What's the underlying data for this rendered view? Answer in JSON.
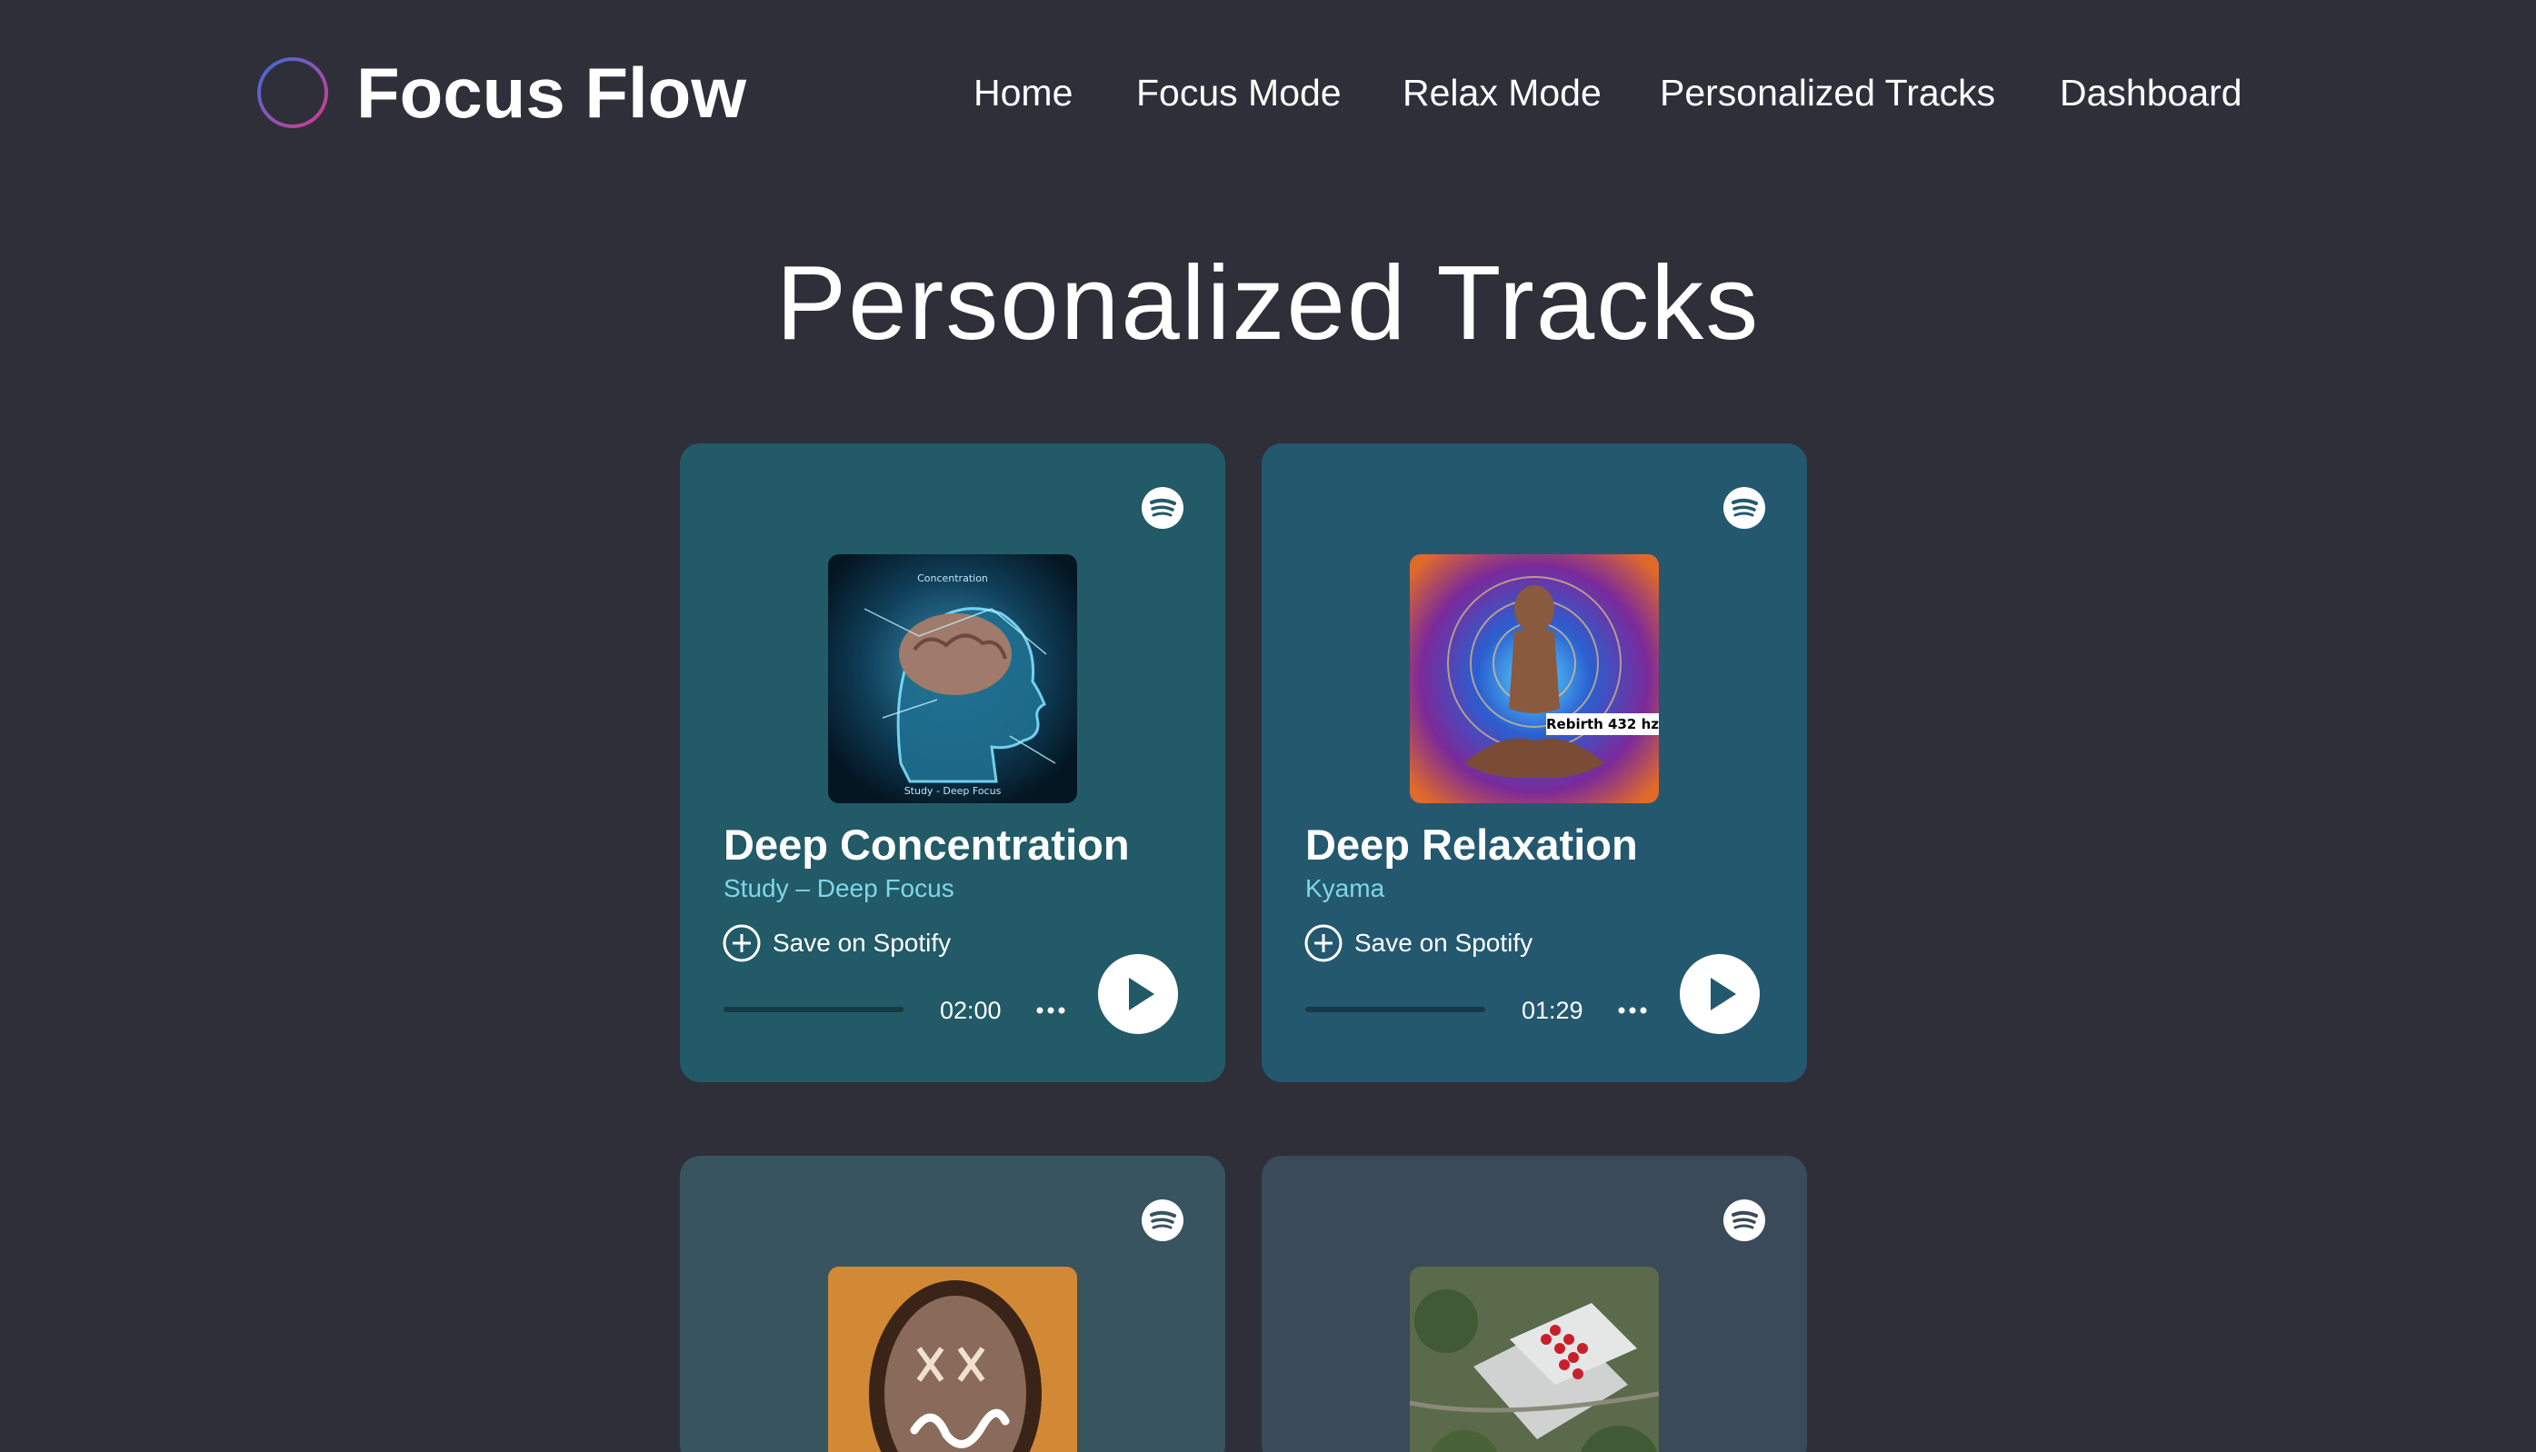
{
  "header": {
    "brand": "Focus Flow",
    "logo_icon": "soundwave-icon",
    "nav": [
      "Home",
      "Focus Mode",
      "Relax Mode",
      "Personalized Tracks",
      "Dashboard"
    ]
  },
  "main": {
    "title": "Personalized Tracks",
    "cards": [
      {
        "title": "Deep Concentration",
        "artist": "Study – Deep Focus",
        "save_label": "Save on Spotify",
        "duration": "02:00",
        "progress": 0,
        "art_text_top": "Concentration",
        "art_text_bottom": "Study - Deep Focus"
      },
      {
        "title": "Deep Relaxation",
        "artist": "Kyama",
        "save_label": "Save on Spotify",
        "duration": "01:29",
        "progress": 0,
        "art_text": "Rebirth 432 hz"
      },
      {},
      {}
    ]
  },
  "colors": {
    "background": "#2f2f3a",
    "card1": "#225a67",
    "card2": "#24586f",
    "card3": "#37545f",
    "card4": "#3a4a58",
    "artist_text": "#7fd6e8",
    "logo_gradient_start": "#3a6ddc",
    "logo_gradient_end": "#d93a8c"
  },
  "icons": [
    "soundwave-icon",
    "spotify-icon",
    "plus-circle-icon",
    "more-dots-icon",
    "play-icon"
  ]
}
